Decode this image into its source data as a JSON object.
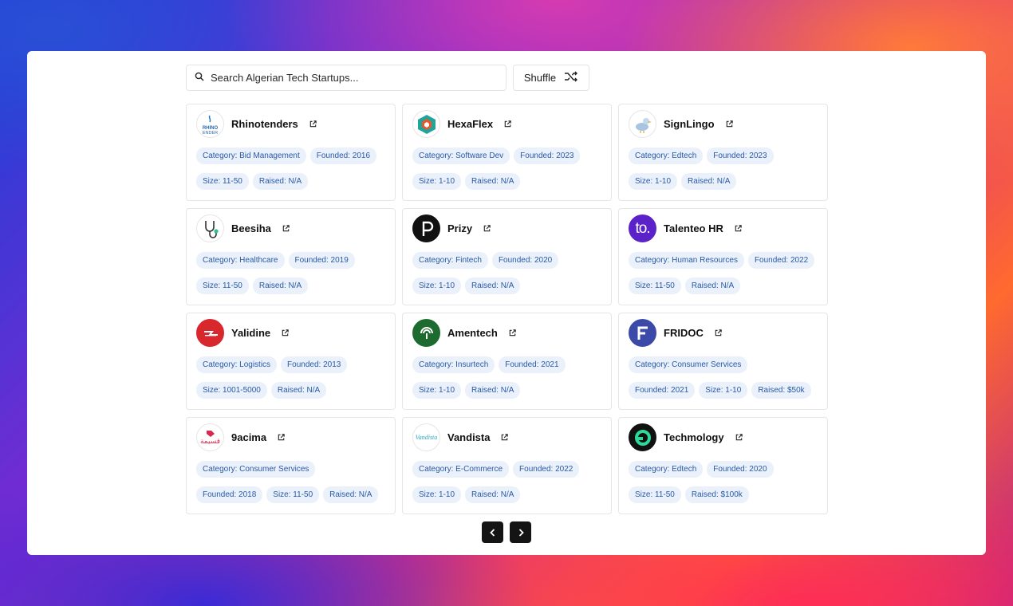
{
  "search": {
    "placeholder": "Search Algerian Tech Startups..."
  },
  "toolbar": {
    "shuffle_label": "Shuffle"
  },
  "startups": [
    {
      "name": "Rhinotenders",
      "category": "Category: Bid Management",
      "founded": "Founded: 2016",
      "size": "Size: 11-50",
      "raised": "Raised: N/A",
      "logo_text": "RHINO ENDER"
    },
    {
      "name": "HexaFlex",
      "category": "Category: Software Dev",
      "founded": "Founded: 2023",
      "size": "Size: 1-10",
      "raised": "Raised: N/A"
    },
    {
      "name": "SignLingo",
      "category": "Category: Edtech",
      "founded": "Founded: 2023",
      "size": "Size: 1-10",
      "raised": "Raised: N/A"
    },
    {
      "name": "Beesiha",
      "category": "Category: Healthcare",
      "founded": "Founded: 2019",
      "size": "Size: 11-50",
      "raised": "Raised: N/A"
    },
    {
      "name": "Prizy",
      "category": "Category: Fintech",
      "founded": "Founded: 2020",
      "size": "Size: 1-10",
      "raised": "Raised: N/A"
    },
    {
      "name": "Talenteo HR",
      "category": "Category: Human Resources",
      "founded": "Founded: 2022",
      "size": "Size: 11-50",
      "raised": "Raised: N/A",
      "logo_text": "to."
    },
    {
      "name": "Yalidine",
      "category": "Category: Logistics",
      "founded": "Founded: 2013",
      "size": "Size: 1001-5000",
      "raised": "Raised: N/A"
    },
    {
      "name": "Amentech",
      "category": "Category: Insurtech",
      "founded": "Founded: 2021",
      "size": "Size: 1-10",
      "raised": "Raised: N/A"
    },
    {
      "name": "FRIDOC",
      "category": "Category: Consumer Services",
      "founded": "Founded: 2021",
      "size": "Size: 1-10",
      "raised": "Raised: $50k"
    },
    {
      "name": "9acima",
      "category": "Category: Consumer Services",
      "founded": "Founded: 2018",
      "size": "Size: 11-50",
      "raised": "Raised: N/A",
      "logo_text": "قسيمة"
    },
    {
      "name": "Vandista",
      "category": "Category: E-Commerce",
      "founded": "Founded: 2022",
      "size": "Size: 1-10",
      "raised": "Raised: N/A",
      "logo_text": "Vandista"
    },
    {
      "name": "Techmology",
      "category": "Category: Edtech",
      "founded": "Founded: 2020",
      "size": "Size: 11-50",
      "raised": "Raised: $100k"
    }
  ],
  "colors": {
    "tag_bg": "#eaf1fb",
    "tag_text": "#2a5aa6",
    "pager_bg": "#141414"
  }
}
